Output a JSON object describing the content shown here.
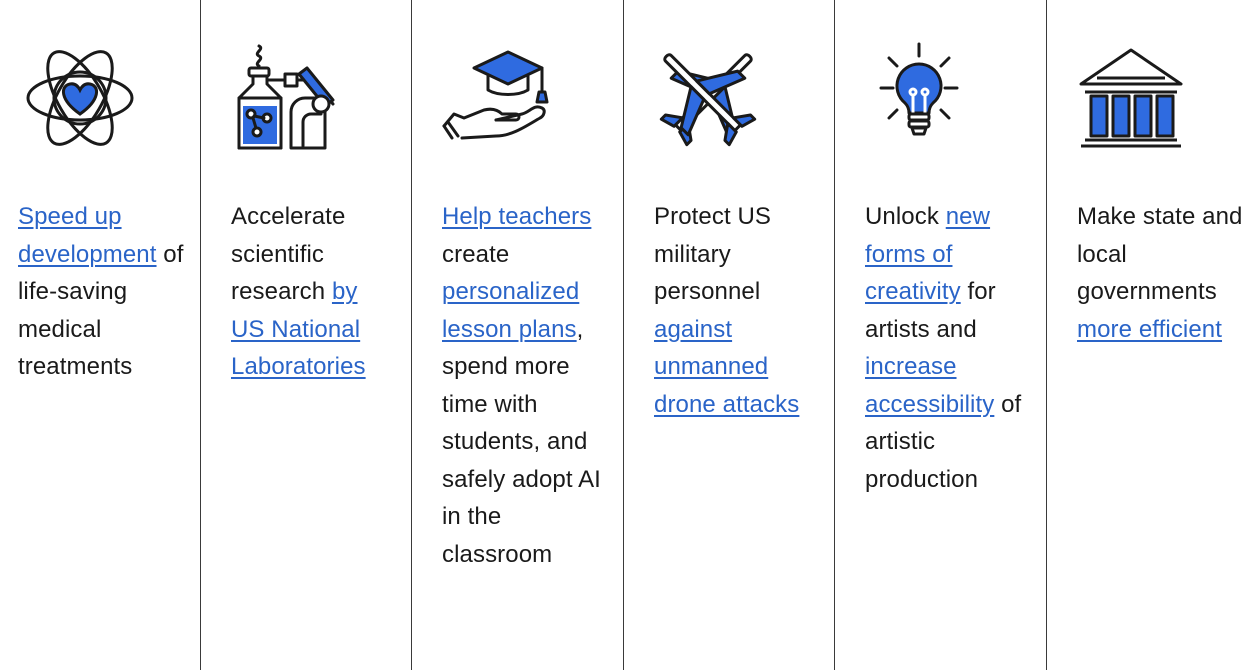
{
  "colors": {
    "accent": "#2a64c8",
    "icon_fill": "#2f6be0",
    "line": "#1a1a1a",
    "divider": "#3a3a3a"
  },
  "columns": [
    {
      "icon": "atom-heart-icon",
      "link1": "Speed up development",
      "text1": " of life-saving medical treatments"
    },
    {
      "icon": "lab-robot-arm-icon",
      "text1": "Accelerate scientific research ",
      "link1": "by US National Laboratories"
    },
    {
      "icon": "hand-graduation-cap-icon",
      "link1": "Help teachers",
      "text1": " create ",
      "link2": "personalized lesson plans",
      "text2": ", spend more time with students, and safely adopt AI in the classroom"
    },
    {
      "icon": "crossed-aircraft-icon",
      "text1": "Protect US military personnel ",
      "link1": "against unmanned drone attacks"
    },
    {
      "icon": "lightbulb-icon",
      "text1": "Unlock ",
      "link1": "new forms of creativity",
      "text2": " for artists and ",
      "link2": "increase accessibility",
      "text3": " of artistic production"
    },
    {
      "icon": "government-building-icon",
      "text1": "Make state and local governments ",
      "link1": "more efficient"
    }
  ]
}
